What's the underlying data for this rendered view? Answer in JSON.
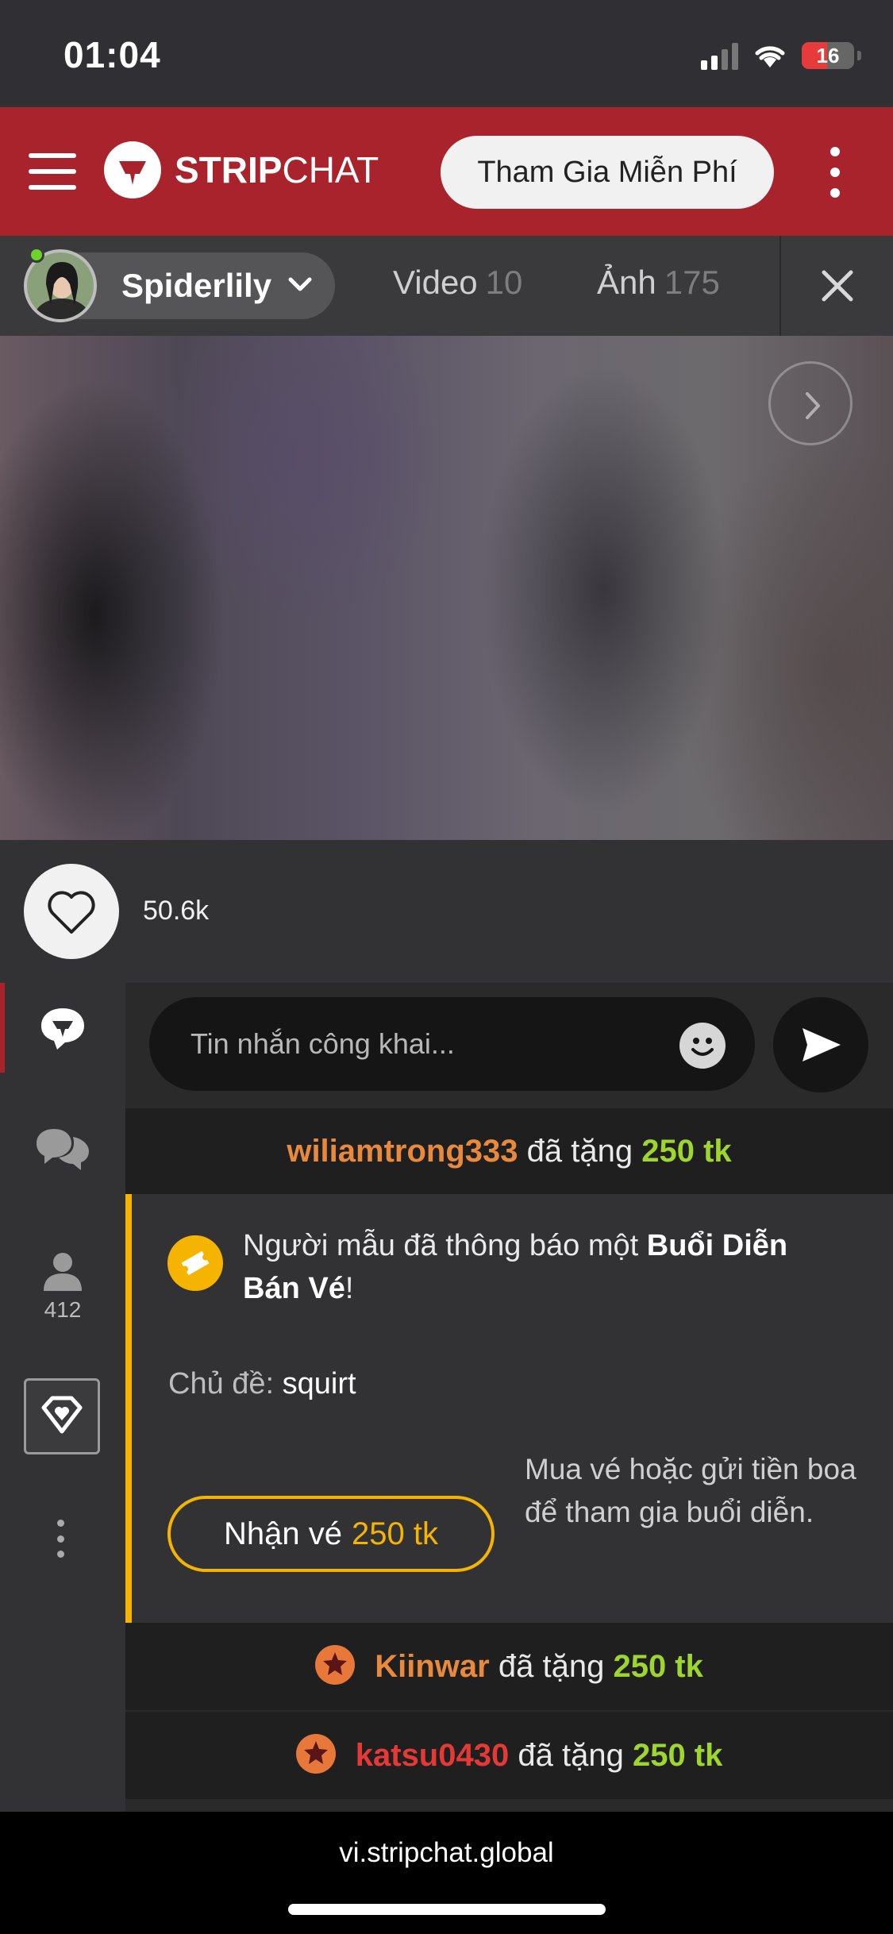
{
  "status_bar": {
    "time": "01:04",
    "battery": "16",
    "battery_level": 0.16
  },
  "header": {
    "logo_bold": "STRIP",
    "logo_light": "CHAT",
    "join_label": "Tham Gia Miễn Phí"
  },
  "model_bar": {
    "name": "Spiderlily",
    "tabs": [
      {
        "label": "Video",
        "count": "10"
      },
      {
        "label": "Ảnh",
        "count": "175"
      }
    ]
  },
  "likes": {
    "count": "50.6k"
  },
  "sidebar": {
    "users_count": "412"
  },
  "chat": {
    "input_placeholder": "Tin nhắn công khai...",
    "messages": [
      {
        "user": "wiliamtrong333",
        "user_color": "#e8893c",
        "verb": "đã tặng",
        "amount": "250 tk"
      },
      {
        "user": "Kiinwar",
        "user_color": "#e8893c",
        "verb": "đã tặng",
        "amount": "250 tk"
      },
      {
        "user": "katsu0430",
        "user_color": "#e53935",
        "verb": "đã tặng",
        "amount": "250 tk"
      }
    ],
    "notice": {
      "text_prefix": "Người mẫu đã thông báo một ",
      "text_bold": "Buổi Diễn Bán Vé",
      "text_suffix": "!",
      "topic_label": "Chủ đề:",
      "topic_value": "squirt",
      "button_label": "Nhận vé",
      "button_price": "250 tk",
      "hint": "Mua vé hoặc gửi tiền boa để tham gia buổi diễn."
    }
  },
  "url_bar": {
    "url": "vi.stripchat.global"
  },
  "colors": {
    "brand": "#a8232c",
    "accent_yellow": "#f4b400",
    "token_green": "#9ed62d"
  }
}
